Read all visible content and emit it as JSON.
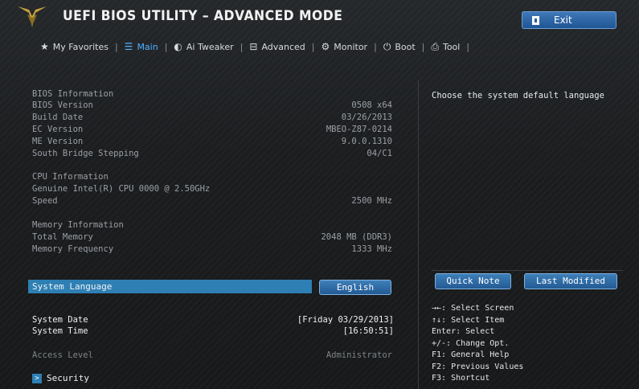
{
  "header": {
    "title": "UEFI BIOS UTILITY – ADVANCED MODE",
    "exit_label": "Exit"
  },
  "tabs": [
    {
      "label": "My Favorites",
      "icon": "star-icon"
    },
    {
      "label": "Main",
      "icon": "list-icon",
      "active": true
    },
    {
      "label": "Ai Tweaker",
      "icon": "tweaker-icon"
    },
    {
      "label": "Advanced",
      "icon": "advanced-icon"
    },
    {
      "label": "Monitor",
      "icon": "monitor-icon"
    },
    {
      "label": "Boot",
      "icon": "power-icon"
    },
    {
      "label": "Tool",
      "icon": "printer-icon"
    }
  ],
  "bios_info": {
    "heading": "BIOS Information",
    "rows": [
      {
        "label": "BIOS Version",
        "value": "0508 x64"
      },
      {
        "label": "Build Date",
        "value": "03/26/2013"
      },
      {
        "label": "EC Version",
        "value": "MBEO-Z87-0214"
      },
      {
        "label": "ME Version",
        "value": "9.0.0.1310"
      },
      {
        "label": "South Bridge Stepping",
        "value": "04/C1"
      }
    ]
  },
  "cpu_info": {
    "heading": "CPU Information",
    "name": "Genuine Intel(R) CPU 0000 @ 2.50GHz",
    "speed_label": "Speed",
    "speed_value": "2500 MHz"
  },
  "memory_info": {
    "heading": "Memory Information",
    "rows": [
      {
        "label": "Total Memory",
        "value": "2048 MB (DDR3)"
      },
      {
        "label": "Memory Frequency",
        "value": "1333 MHz"
      }
    ]
  },
  "system_language": {
    "label": "System Language",
    "value": "English"
  },
  "system_date": {
    "label": "System Date",
    "value": "[Friday 03/29/2013]"
  },
  "system_time": {
    "label": "System Time",
    "value": "[16:50:51]"
  },
  "access_level": {
    "label": "Access Level",
    "value": "Administrator"
  },
  "security": {
    "label": "Security"
  },
  "help": {
    "text": "Choose the system default language",
    "quick_note": "Quick Note",
    "last_modified": "Last Modified",
    "keys": [
      "→←: Select Screen",
      "↑↓: Select Item",
      "Enter: Select",
      "+/-: Change Opt.",
      "F1: General Help",
      "F2: Previous Values",
      "F3: Shortcut"
    ]
  },
  "colors": {
    "accent": "#2e7fb3",
    "active_tab": "#4fb0ff",
    "background": "#1a1c1e"
  }
}
